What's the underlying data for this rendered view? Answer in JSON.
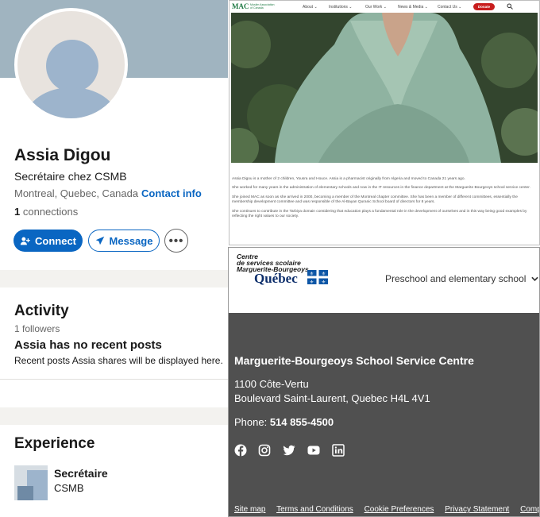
{
  "linkedin": {
    "name": "Assia Digou",
    "headline": "Secrétaire chez CSMB",
    "location": "Montreal, Quebec, Canada",
    "contact_info": "Contact info",
    "connections_count": "1",
    "connections_label": " connections",
    "buttons": {
      "connect": "Connect",
      "message": "Message",
      "more": "•••"
    },
    "activity": {
      "title": "Activity",
      "followers": "1 followers",
      "no_posts": "Assia has no recent posts",
      "note": "Recent posts Assia shares will be displayed here."
    },
    "experience": {
      "title": "Experience",
      "role": "Secrétaire",
      "company": "CSMB"
    },
    "colors": {
      "primary": "#0a66c2",
      "banner": "#a0b4c0",
      "separator": "#f3f2ef"
    }
  },
  "mac": {
    "logo": "MAC",
    "logo_sub_1": "Muslim Association",
    "logo_sub_2": "of Canada",
    "nav": [
      "About",
      "Institutions",
      "Our Work",
      "News & Media",
      "Contact Us"
    ],
    "donate": "Donate",
    "paragraphs": [
      "Assia Digou is a mother of 2 children, Yousra and Houce. Assia is a pharmacist originally from Algeria and moved to Canada 21 years ago.",
      "She worked for many years in the administration of elementary schools and now in the IT resources in the finance department at the Marguerite Bourgeoys school service center.",
      "She joined MAC as soon as she arrived in 2000, becoming a member of the Montreal chapter committee. She has been a member of different committees, essentially the membership development committee and was responsible of the Al-Bayan Quranic School board of directors for 8 years.",
      "She continues to contribute in the Tarbiya domain considering that education plays a fundamental role in the development of ourselves and in this way being good examples by reflecting the right values to our society."
    ],
    "colors": {
      "brand": "#1f7a44",
      "donate": "#c81e1e"
    }
  },
  "cssmb": {
    "logo_line1": "Centre",
    "logo_line2": "de services scolaire",
    "logo_line3": "Marguerite-Bourgeoys",
    "quebec": "Québec",
    "dropdown": "Preschool and elementary school",
    "org": "Marguerite-Bourgeoys School Service Centre",
    "address1": "1100 Côte-Vertu",
    "address2": "Boulevard Saint-Laurent, Quebec H4L 4V1",
    "phone_label": "Phone: ",
    "phone": "514 855-4500",
    "social": [
      "facebook-icon",
      "instagram-icon",
      "twitter-icon",
      "youtube-icon",
      "linkedin-icon"
    ],
    "links": [
      "Site map",
      "Terms and Conditions",
      "Cookie Preferences",
      "Privacy Statement",
      "Complaint"
    ],
    "colors": {
      "footer": "#505050",
      "quebec_blue": "#0d2e6b"
    }
  }
}
